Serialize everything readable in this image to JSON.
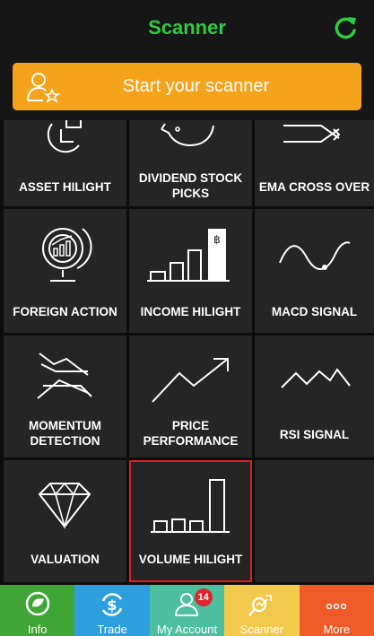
{
  "header": {
    "title": "Scanner"
  },
  "start": {
    "label": "Start your scanner"
  },
  "tiles": [
    {
      "label": "ASSET HILIGHT"
    },
    {
      "label": "DIVIDEND STOCK PICKS"
    },
    {
      "label": "EMA CROSS OVER"
    },
    {
      "label": "FOREIGN ACTION"
    },
    {
      "label": "INCOME HILIGHT"
    },
    {
      "label": "MACD SIGNAL"
    },
    {
      "label": "MOMENTUM DETECTION"
    },
    {
      "label": "PRICE PERFORMANCE"
    },
    {
      "label": "RSI SIGNAL"
    },
    {
      "label": "VALUATION"
    },
    {
      "label": "VOLUME HILIGHT"
    }
  ],
  "tabs": [
    {
      "label": "Info",
      "color": "#3fa535"
    },
    {
      "label": "Trade",
      "color": "#2d9fdf"
    },
    {
      "label": "My Account",
      "color": "#4bbf9f",
      "badge": "14"
    },
    {
      "label": "Scanner",
      "color": "#f2c94c"
    },
    {
      "label": "More",
      "color": "#f05a28"
    }
  ],
  "colors": {
    "accent": "#2ecc40",
    "start_button": "#f5a31a",
    "selected_outline": "#e02020"
  }
}
